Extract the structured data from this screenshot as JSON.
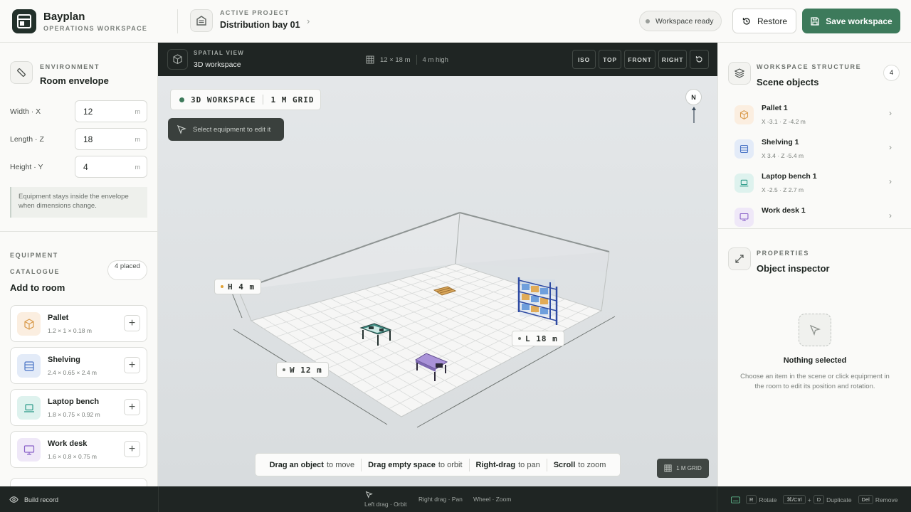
{
  "header": {
    "brand_name": "Bayplan",
    "brand_sub": "OPERATIONS WORKSPACE",
    "project_label": "ACTIVE PROJECT",
    "project_name": "Distribution bay 01",
    "status": "Workspace ready",
    "restore_label": "Restore",
    "save_label": "Save workspace"
  },
  "environment": {
    "kicker": "ENVIRONMENT",
    "title": "Room envelope",
    "fields": [
      {
        "label": "Width · X",
        "value": "12",
        "unit": "m"
      },
      {
        "label": "Length · Z",
        "value": "18",
        "unit": "m"
      },
      {
        "label": "Height · Y",
        "value": "4",
        "unit": "m"
      }
    ],
    "note": "Equipment stays inside the envelope when dimensions change."
  },
  "catalogue": {
    "kicker1": "EQUIPMENT",
    "kicker2": "CATALOGUE",
    "title": "Add to room",
    "placed": "4 placed",
    "items": [
      {
        "name": "Pallet",
        "dims": "1.2 × 1 × 0.18 m",
        "color": "#fbeee0"
      },
      {
        "name": "Shelving",
        "dims": "2.4 × 0.65 × 2.4 m",
        "color": "#e3ebf8"
      },
      {
        "name": "Laptop bench",
        "dims": "1.8 × 0.75 × 0.92 m",
        "color": "#def2ee"
      },
      {
        "name": "Work desk",
        "dims": "1.6 × 0.8 × 0.75 m",
        "color": "#efe8f8"
      }
    ]
  },
  "viewport": {
    "kicker": "SPATIAL VIEW",
    "title": "3D workspace",
    "dims": "12 × 18 m",
    "height": "4 m high",
    "views": [
      "ISO",
      "TOP",
      "FRONT",
      "RIGHT"
    ],
    "chip_mode": "3D WORKSPACE",
    "chip_grid": "1 M GRID",
    "tip": "Select equipment to edit it",
    "compass": "N",
    "label_h": "H 4 m",
    "label_w": "W 12 m",
    "label_l": "L 18 m",
    "hints": [
      {
        "action": "Drag an object",
        "effect": "to move"
      },
      {
        "action": "Drag empty space",
        "effect": "to orbit"
      },
      {
        "action": "Right-drag",
        "effect": "to pan"
      },
      {
        "action": "Scroll",
        "effect": "to zoom"
      }
    ],
    "grid_badge": "1 M GRID"
  },
  "structure": {
    "kicker": "WORKSPACE STRUCTURE",
    "title": "Scene objects",
    "count": "4",
    "objects": [
      {
        "name": "Pallet 1",
        "coords": "X -3.1 · Z -4.2 m",
        "color": "#fbeee0"
      },
      {
        "name": "Shelving 1",
        "coords": "X 3.4 · Z -5.4 m",
        "color": "#e3ebf8"
      },
      {
        "name": "Laptop bench 1",
        "coords": "X -2.5 · Z 2.7 m",
        "color": "#def2ee"
      },
      {
        "name": "Work desk 1",
        "coords": "",
        "color": "#efe8f8"
      }
    ]
  },
  "properties": {
    "kicker": "PROPERTIES",
    "title": "Object inspector",
    "empty_title": "Nothing selected",
    "empty_desc": "Choose an item in the scene or click equipment in the room to edit its position and rotation."
  },
  "footer": {
    "build_record": "Build record",
    "left_drag": "Left drag · Orbit",
    "right_drag": "Right drag · Pan",
    "wheel": "Wheel · Zoom",
    "k_rotate": "R",
    "rotate": "Rotate",
    "k_ctrl": "⌘/Ctrl",
    "plus": "+",
    "k_dup": "D",
    "duplicate": "Duplicate",
    "k_del": "Del",
    "remove": "Remove"
  }
}
